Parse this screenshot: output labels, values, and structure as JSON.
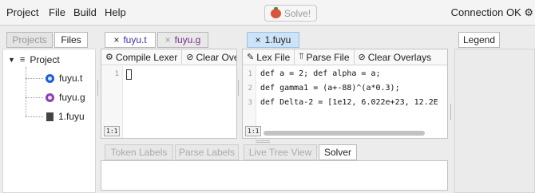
{
  "menu": {
    "project": "Project",
    "file": "File",
    "build": "Build",
    "help": "Help"
  },
  "solve_button": {
    "label": "Solve!"
  },
  "status": {
    "connection": "Connection OK ⚙"
  },
  "left_panel": {
    "tabs": [
      {
        "label": "Projects"
      },
      {
        "label": "Files"
      }
    ],
    "tree": {
      "root": "Project",
      "items": [
        {
          "label": "fuyu.t",
          "icon": "lexer-circle-blue"
        },
        {
          "label": "fuyu.g",
          "icon": "grammar-circle-purple"
        },
        {
          "label": "1.fuyu",
          "icon": "document-icon"
        }
      ]
    }
  },
  "editor_left": {
    "tabs": [
      {
        "close": "×",
        "label": "fuyu.t"
      },
      {
        "close": "×",
        "label": "fuyu.g"
      }
    ],
    "toolbar": {
      "compile": "Compile Lexer",
      "clear": "Clear Ove"
    },
    "lines": [
      "1"
    ],
    "position": "1:1"
  },
  "editor_right": {
    "tab": {
      "close": "×",
      "label": "1.fuyu"
    },
    "toolbar": {
      "lex": "Lex File",
      "parse": "Parse File",
      "clear": "Clear Overlays"
    },
    "lines": [
      {
        "num": "1",
        "text": "def a = 2; def alpha = a;"
      },
      {
        "num": "2",
        "text": "def gamma1 = (a+-88)^(a*0.3);"
      },
      {
        "num": "3",
        "text": "def Delta-2 = [1e12, 6.022e+23, 12.2E"
      }
    ],
    "position": "1:1"
  },
  "bottom_tabs": [
    {
      "label": "Token Labels"
    },
    {
      "label": "Parse Labels"
    },
    {
      "label": "Live Tree View"
    },
    {
      "label": "Solver"
    }
  ],
  "legend": {
    "label": "Legend"
  }
}
